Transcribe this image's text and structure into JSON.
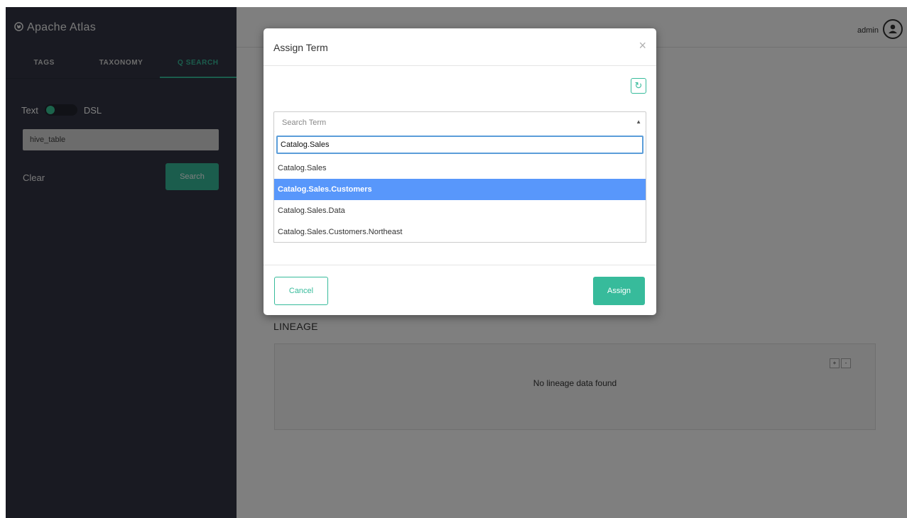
{
  "sidebar": {
    "brand": "Apache Atlas",
    "tabs": [
      {
        "label": "TAGS"
      },
      {
        "label": "TAXONOMY"
      },
      {
        "label": "Q SEARCH"
      }
    ],
    "toggle_left": "Text",
    "toggle_right": "DSL",
    "search_value": "hive_table",
    "clear_label": "Clear",
    "search_button": "Search"
  },
  "header": {
    "username": "admin"
  },
  "main": {
    "lineage_title": "LINEAGE",
    "lineage_empty": "No lineage data found",
    "zoom_in": "+",
    "zoom_out": "-"
  },
  "modal": {
    "title": "Assign Term",
    "close": "×",
    "refresh": "↻",
    "select_placeholder": "Search Term",
    "select_arrow": "▲",
    "query": "Catalog.Sales",
    "options": [
      {
        "label": "Catalog.Sales"
      },
      {
        "label": "Catalog.Sales.Customers"
      },
      {
        "label": "Catalog.Sales.Data"
      },
      {
        "label": "Catalog.Sales.Customers.Northeast"
      }
    ],
    "highlighted_option": "Catalog.Sales.Customers",
    "cancel_button": "Cancel",
    "assign_button": "Assign"
  },
  "colors": {
    "accent": "#37bb9b",
    "sidebar_bg": "#323544",
    "highlight": "#5897fb"
  }
}
